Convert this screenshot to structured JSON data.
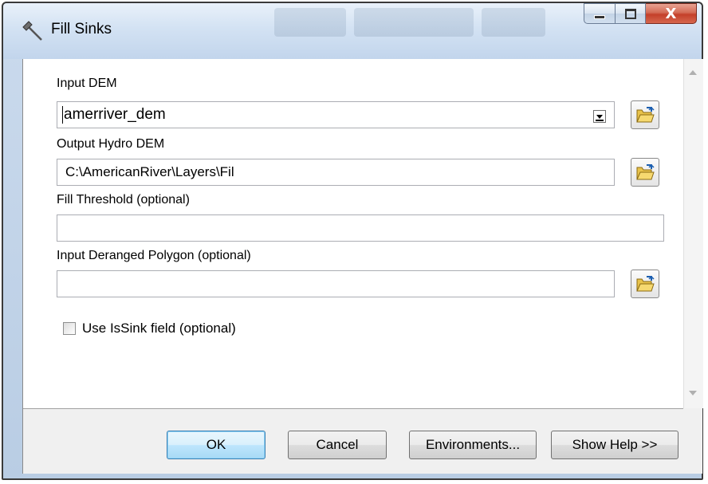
{
  "window": {
    "title": "Fill Sinks",
    "title_icon": "hammer-icon",
    "caption_buttons": {
      "minimize_icon": "minimize-icon",
      "maximize_icon": "maximize-icon",
      "close_label": "X"
    }
  },
  "form": {
    "input_dem": {
      "label": "Input DEM",
      "value": "amerriver_dem"
    },
    "output_hydro_dem": {
      "label": "Output Hydro DEM",
      "value": "C:\\AmericanRiver\\Layers\\Fil"
    },
    "fill_threshold": {
      "label": "Fill Threshold (optional)",
      "value": ""
    },
    "input_deranged_polygon": {
      "label": "Input Deranged Polygon (optional)",
      "value": ""
    },
    "use_issink": {
      "label": "Use IsSink field (optional)",
      "checked": false
    }
  },
  "buttons": {
    "ok": "OK",
    "cancel": "Cancel",
    "environments": "Environments...",
    "show_help": "Show Help >>"
  },
  "colors": {
    "title_bar": "#d3e2f3",
    "close_button": "#c4402a",
    "ok_button_border": "#3c7fb1"
  }
}
